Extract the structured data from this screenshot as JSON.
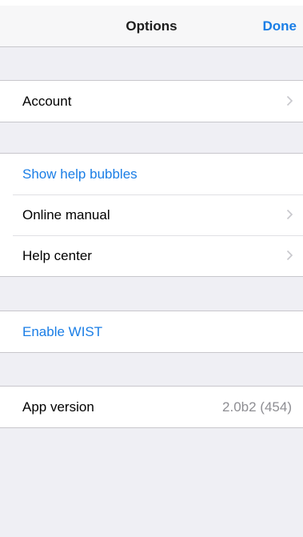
{
  "navbar": {
    "title": "Options",
    "done_label": "Done"
  },
  "groups": {
    "account": {
      "items": [
        {
          "label": "Account",
          "accessory": "chevron-right-icon"
        }
      ]
    },
    "help": {
      "items": [
        {
          "label": "Show help bubbles"
        },
        {
          "label": "Online manual",
          "accessory": "chevron-right-icon"
        },
        {
          "label": "Help center",
          "accessory": "chevron-right-icon"
        }
      ]
    },
    "wist": {
      "items": [
        {
          "label": "Enable WIST"
        }
      ]
    },
    "about": {
      "items": [
        {
          "label": "App version",
          "value": "2.0b2 (454)"
        }
      ]
    }
  },
  "colors": {
    "accent": "#1a7ee6",
    "background": "#efeff4",
    "secondary_text": "#8e8e93"
  }
}
